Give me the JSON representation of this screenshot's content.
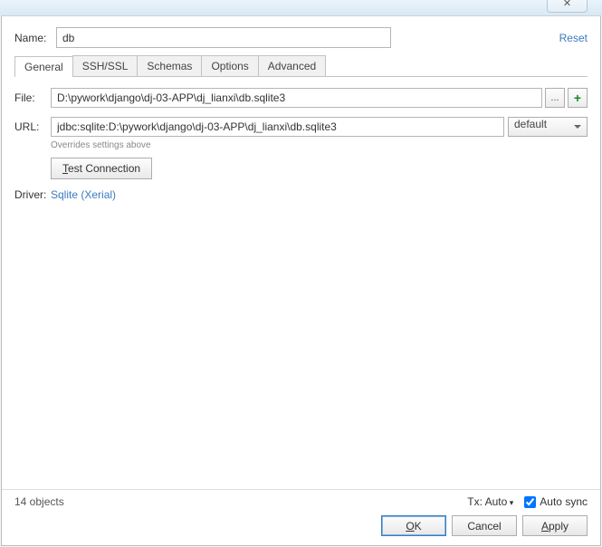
{
  "titlebar": {
    "close_glyph": "✕"
  },
  "header": {
    "name_label": "Name:",
    "name_value": "db",
    "reset_label": "Reset"
  },
  "tabs": [
    {
      "label": "General",
      "active": true
    },
    {
      "label": "SSH/SSL"
    },
    {
      "label": "Schemas"
    },
    {
      "label": "Options"
    },
    {
      "label": "Advanced"
    }
  ],
  "general": {
    "file_label": "File:",
    "file_value": "D:\\pywork\\django\\dj-03-APP\\dj_lianxi\\db.sqlite3",
    "browse_label": "...",
    "url_label": "URL:",
    "url_value": "jdbc:sqlite:D:\\pywork\\django\\dj-03-APP\\dj_lianxi\\db.sqlite3",
    "auth_value": "default",
    "override_hint": "Overrides settings above",
    "test_label_pre": "",
    "test_underline": "T",
    "test_label_post": "est Connection",
    "driver_label": "Driver:",
    "driver_link": "Sqlite (Xerial)"
  },
  "footer": {
    "objects": "14 objects",
    "tx_label": "Tx: Auto",
    "autosync_label": "Auto sync",
    "autosync_checked": true,
    "ok_u": "O",
    "ok_rest": "K",
    "cancel": "Cancel",
    "apply_u": "A",
    "apply_rest": "pply"
  }
}
